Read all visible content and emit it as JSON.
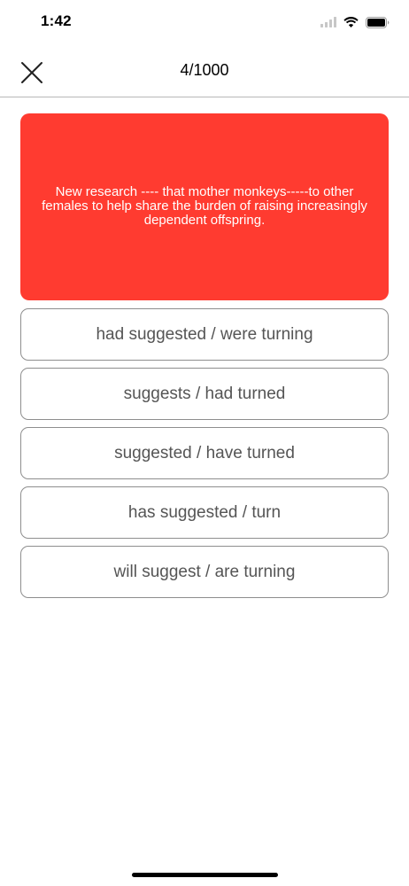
{
  "status_bar": {
    "time": "1:42",
    "icons": [
      "cellular-signal-icon",
      "wifi-icon",
      "battery-icon"
    ]
  },
  "nav": {
    "close_icon": "close-icon",
    "title": "4/1000"
  },
  "question": {
    "text": "New research ---- that mother monkeys-----to other females to help share the burden of raising increasingly dependent offspring.",
    "background_color": "#ff3b30"
  },
  "options": [
    {
      "label": "had suggested / were turning"
    },
    {
      "label": "suggests / had turned"
    },
    {
      "label": "suggested / have turned"
    },
    {
      "label": "has suggested / turn"
    },
    {
      "label": "will suggest / are turning"
    }
  ]
}
